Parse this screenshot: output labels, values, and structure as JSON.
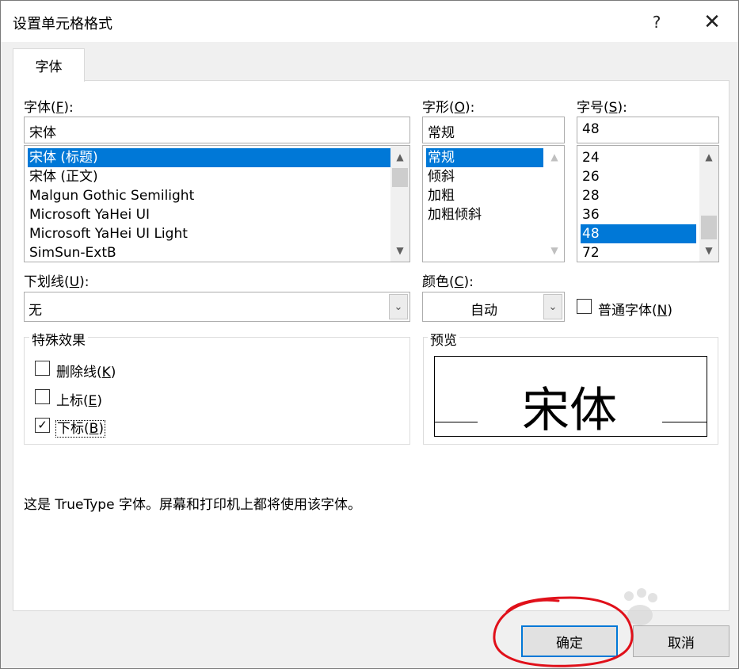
{
  "dialog": {
    "title": "设置单元格格式",
    "help_glyph": "?",
    "close_glyph": "✕"
  },
  "tabs": [
    {
      "label": "字体",
      "selected": true
    }
  ],
  "font": {
    "label_prefix": "字体(",
    "label_key": "F",
    "label_suffix": "):",
    "value": "宋体",
    "items": [
      "宋体 (标题)",
      "宋体 (正文)",
      "Malgun Gothic Semilight",
      "Microsoft YaHei UI",
      "Microsoft YaHei UI Light",
      "SimSun-ExtB"
    ],
    "selected_index": 0
  },
  "style": {
    "label_prefix": "字形(",
    "label_key": "O",
    "label_suffix": "):",
    "value": "常规",
    "items": [
      "常规",
      "倾斜",
      "加粗",
      "加粗倾斜"
    ],
    "selected_index": 0
  },
  "size": {
    "label_prefix": "字号(",
    "label_key": "S",
    "label_suffix": "):",
    "value": "48",
    "items": [
      "24",
      "26",
      "28",
      "36",
      "48",
      "72"
    ],
    "selected_index": 4
  },
  "underline": {
    "label_prefix": "下划线(",
    "label_key": "U",
    "label_suffix": "):",
    "value": "无"
  },
  "color": {
    "label_prefix": "颜色(",
    "label_key": "C",
    "label_suffix": "):",
    "value": "自动"
  },
  "normal_font": {
    "label_prefix": "普通字体(",
    "label_key": "N",
    "label_suffix": ")",
    "checked": false
  },
  "effects": {
    "title": "特殊效果",
    "items": [
      {
        "label_prefix": "删除线(",
        "label_key": "K",
        "label_suffix": ")",
        "checked": false
      },
      {
        "label_prefix": "上标(",
        "label_key": "E",
        "label_suffix": ")",
        "checked": false
      },
      {
        "label_prefix": "下标(",
        "label_key": "B",
        "label_suffix": ")",
        "checked": true,
        "check_glyph": "✓"
      }
    ]
  },
  "preview": {
    "title": "预览",
    "sample_text": "宋体"
  },
  "info_text": "这是 TrueType 字体。屏幕和打印机上都将使用该字体。",
  "buttons": {
    "ok": "确定",
    "cancel": "取消"
  },
  "colors": {
    "selection": "#0078d7",
    "annotation": "#e0101a"
  },
  "icons": {
    "scroll_up": "▲",
    "scroll_down": "▼",
    "combo_arrow": "⌄"
  }
}
